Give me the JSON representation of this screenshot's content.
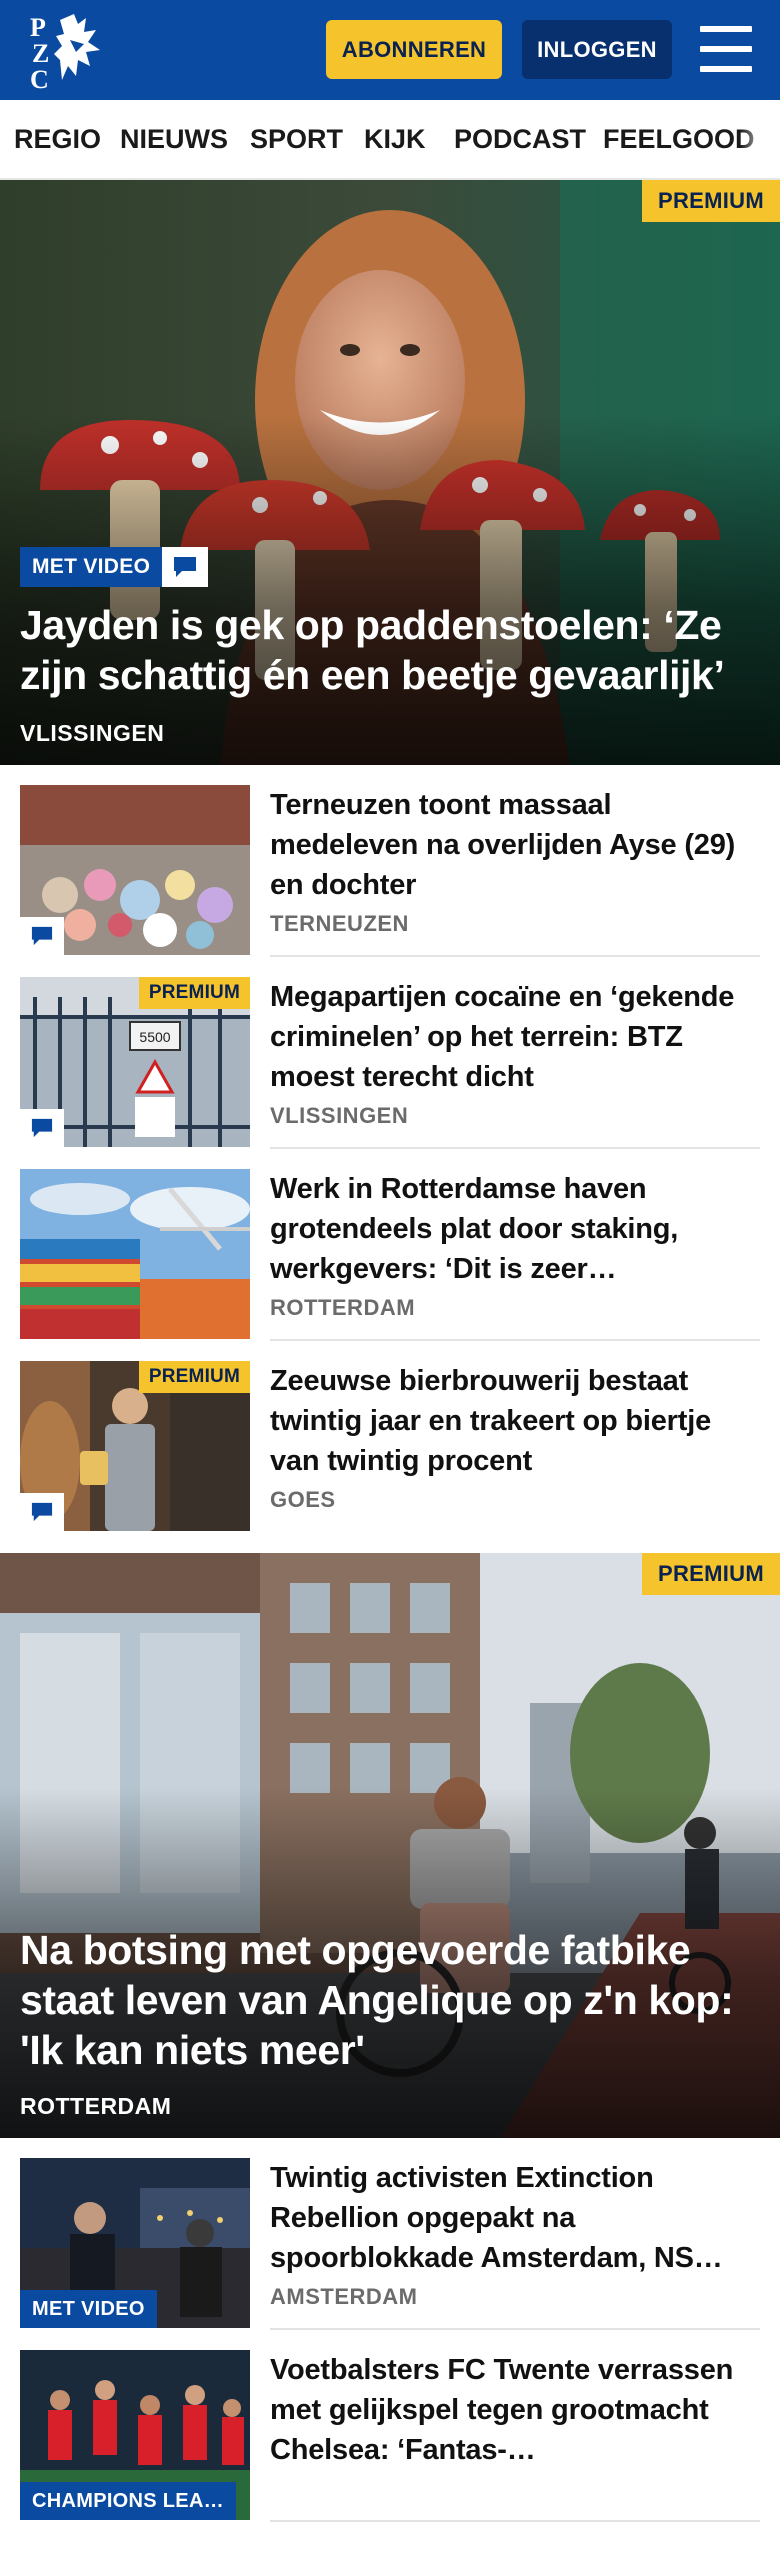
{
  "header": {
    "logo_text": "PZC",
    "subscribe_label": "ABONNEREN",
    "login_label": "INLOGGEN",
    "menu_icon": "hamburger-menu-icon"
  },
  "nav": {
    "items": [
      "REGIO",
      "NIEUWS",
      "SPORT",
      "KIJK",
      "PODCAST",
      "FEELGOOD"
    ]
  },
  "hero1": {
    "premium": "PREMIUM",
    "video_label": "MET VIDEO",
    "title": "Jayden is gek op paddenstoelen: ‘Ze zijn schattig én een beetje gevaarlijk’",
    "location": "VLISSINGEN"
  },
  "articles": [
    {
      "title": "Terneuzen toont massaal medeleven na overlijden Ayse (29) en dochter",
      "location": "TERNEUZEN",
      "has_comments": true
    },
    {
      "title": "Megapartijen cocaïne en ‘gekende criminelen’ op het terrein: BTZ moest terecht dicht",
      "location": "VLISSINGEN",
      "premium": "PREMIUM",
      "has_comments": true,
      "sign_text": "5500"
    },
    {
      "title": "Werk in Rotterdamse haven grotendeels plat door staking, werkgevers: ‘Dit is zeer…",
      "location": "ROTTERDAM"
    },
    {
      "title": "Zeeuwse bierbrouwerij bestaat twintig jaar en trakeert op biertje van twintig procent",
      "location": "GOES",
      "premium": "PREMIUM",
      "has_comments": true
    }
  ],
  "hero2": {
    "premium": "PREMIUM",
    "title": "Na botsing met opgevoerde fatbike staat leven van Angelique op z'n kop: 'Ik kan niets meer'",
    "location": "ROTTERDAM"
  },
  "articles2": [
    {
      "title": "Twintig activisten Extinction Rebellion opgepakt na spoorblokkade Amsterdam, NS…",
      "location": "AMSTERDAM",
      "label": "MET VIDEO"
    },
    {
      "title": "Voetbalsters FC Twente verrassen met gelijkspel tegen grootmacht Chelsea: ‘Fantas-…",
      "label": "CHAMPIONS LEA…"
    }
  ],
  "colors": {
    "brand_blue": "#0a4aa0",
    "premium_yellow": "#f5c32c",
    "login_blue": "#08306e",
    "location_grey": "#6b6b6b"
  }
}
